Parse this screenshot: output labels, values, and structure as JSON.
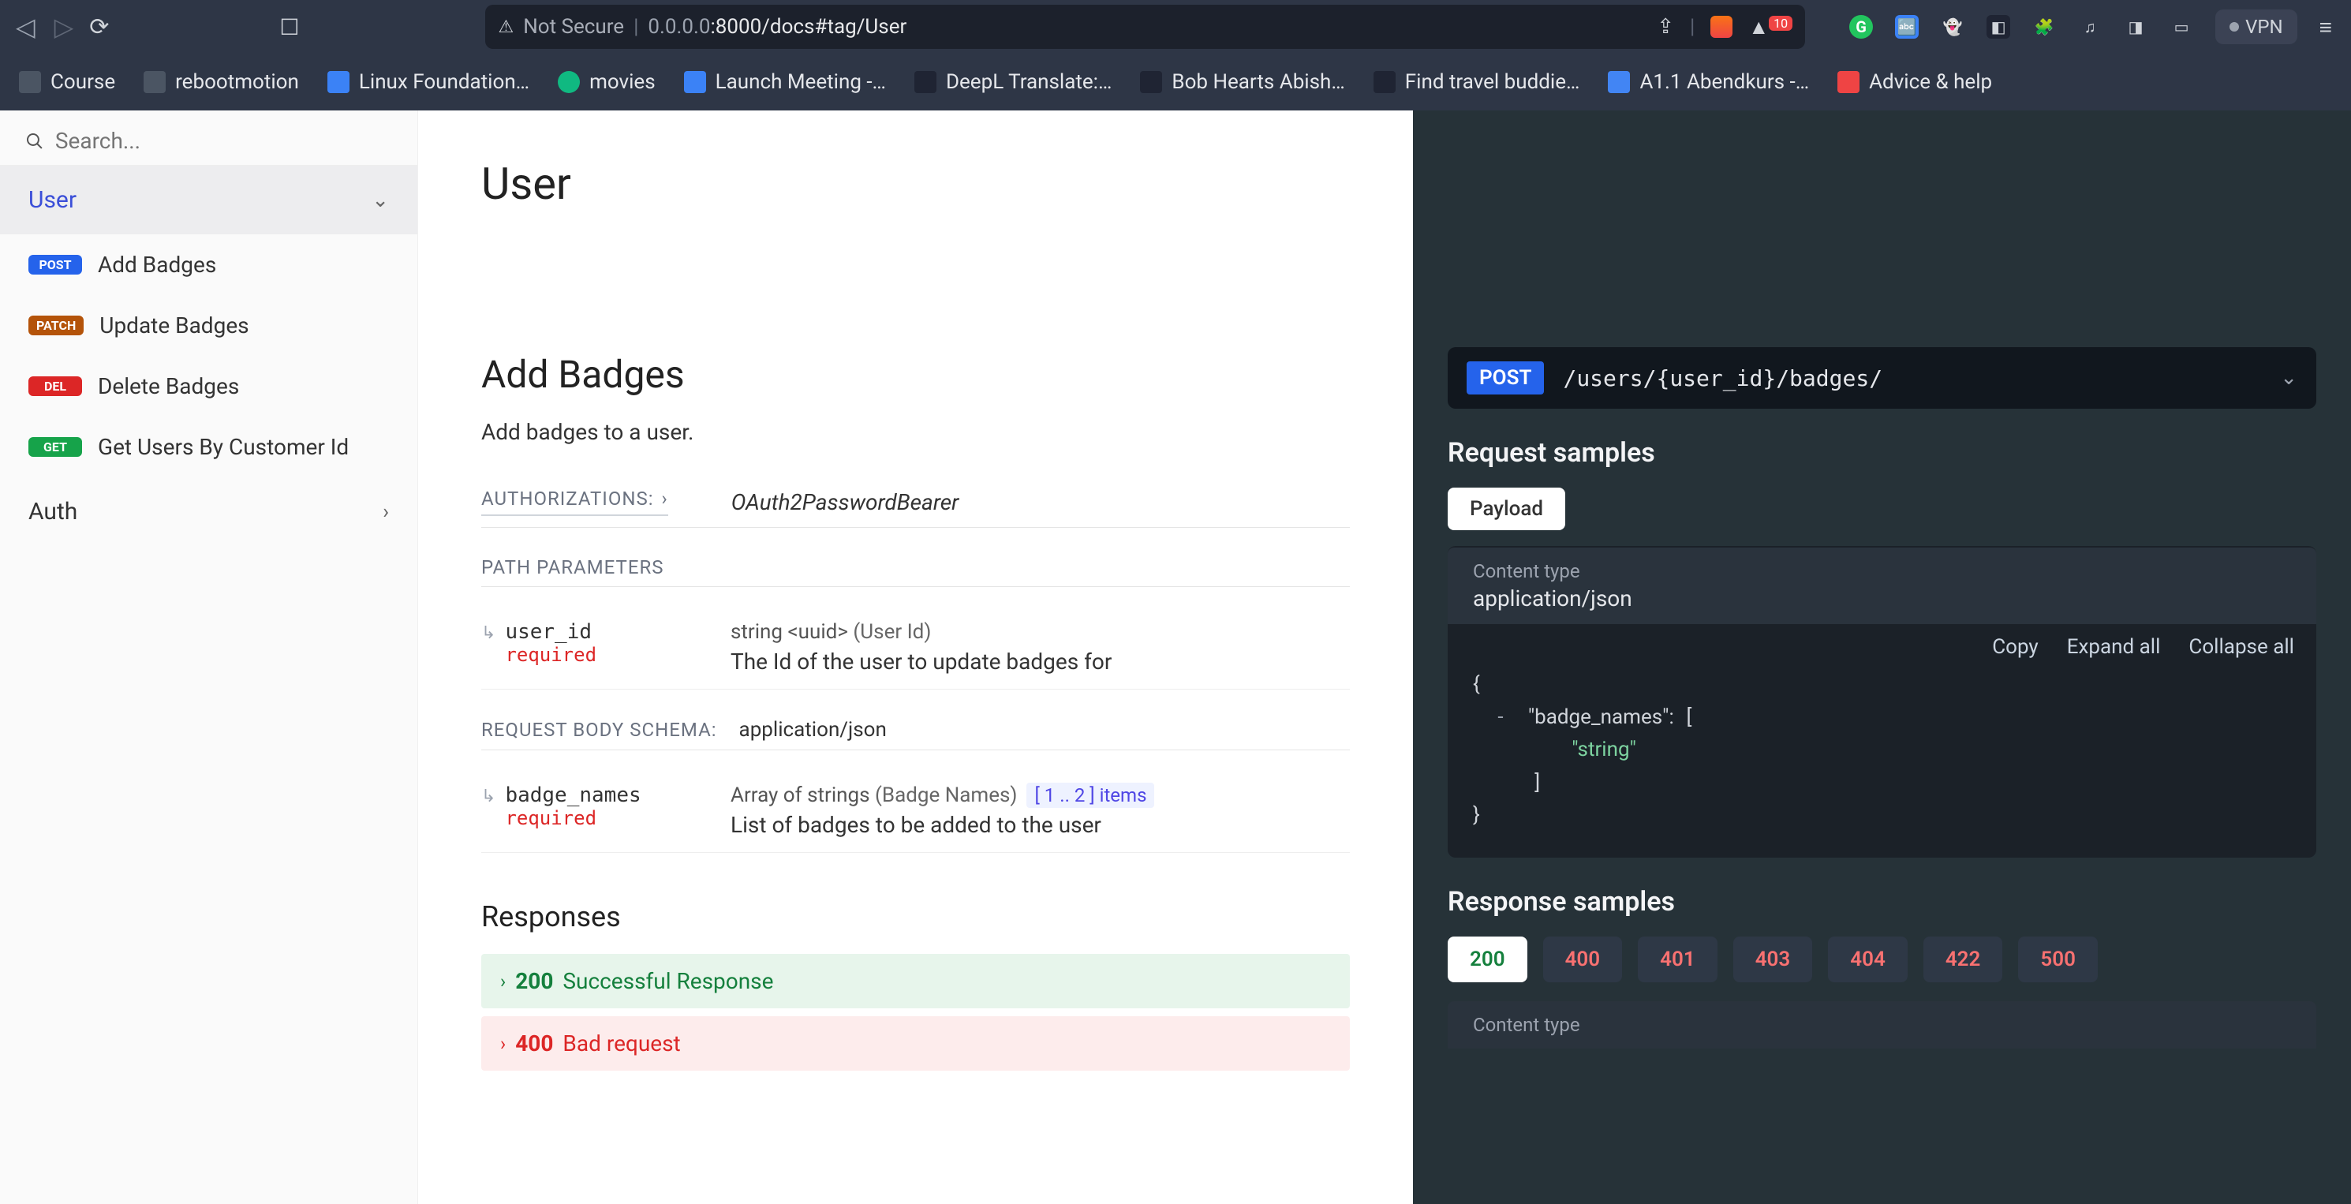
{
  "browser": {
    "not_secure": "Not Secure",
    "host_dim": "0.0.0.0",
    "host_rest": ":8000/docs#tag/User",
    "vpn": "VPN",
    "ext_badge": "10"
  },
  "bookmarks": [
    {
      "label": "Course",
      "iconClass": "bm-folder"
    },
    {
      "label": "rebootmotion",
      "iconClass": "bm-folder"
    },
    {
      "label": "Linux Foundation…",
      "iconClass": "bm-blue"
    },
    {
      "label": "movies",
      "iconClass": "bm-green"
    },
    {
      "label": "Launch Meeting -…",
      "iconClass": "bm-blue"
    },
    {
      "label": "DeepL Translate:…",
      "iconClass": "bm-dark"
    },
    {
      "label": "Bob Hearts Abish…",
      "iconClass": "bm-dark"
    },
    {
      "label": "Find travel buddie…",
      "iconClass": "bm-dark"
    },
    {
      "label": "A1.1 Abendkurs -…",
      "iconClass": "bm-doc"
    },
    {
      "label": "Advice & help",
      "iconClass": "bm-red"
    }
  ],
  "search": {
    "placeholder": "Search..."
  },
  "sidebar": {
    "section_user": "User",
    "section_auth": "Auth",
    "items": [
      {
        "method": "POST",
        "methodClass": "method-post",
        "label": "Add Badges"
      },
      {
        "method": "PATCH",
        "methodClass": "method-patch",
        "label": "Update Badges"
      },
      {
        "method": "DEL",
        "methodClass": "method-del",
        "label": "Delete Badges"
      },
      {
        "method": "GET",
        "methodClass": "method-get",
        "label": "Get Users By Customer Id"
      }
    ]
  },
  "content": {
    "page_title": "User",
    "op_title": "Add Badges",
    "op_desc": "Add badges to a user.",
    "authz_label": "AUTHORIZATIONS:",
    "authz_value": "OAuth2PasswordBearer",
    "path_params_label": "PATH PARAMETERS",
    "param1": {
      "name": "user_id",
      "req": "required",
      "type": "string <uuid>",
      "paren": "(User Id)",
      "desc": "The Id of the user to update badges for"
    },
    "req_body_label": "REQUEST BODY SCHEMA:",
    "req_body_ct": "application/json",
    "param2": {
      "name": "badge_names",
      "req": "required",
      "type": "Array of strings",
      "paren": "(Badge Names)",
      "range": "[ 1 .. 2 ] items",
      "desc": "List of badges to be added to the user"
    },
    "responses_label": "Responses",
    "resp_ok_code": "200",
    "resp_ok_text": "Successful Response",
    "resp_bad_code": "400",
    "resp_bad_text": "Bad request"
  },
  "panel": {
    "method": "POST",
    "path": "/users/{user_id}/badges/",
    "req_samples": "Request samples",
    "payload_tab": "Payload",
    "ct_label": "Content type",
    "ct_val": "application/json",
    "copy": "Copy",
    "expand": "Expand all",
    "collapse": "Collapse all",
    "json": {
      "open": "{",
      "dash": "-",
      "key": "\"badge_names\":",
      "bopen": "[",
      "str": "\"string\"",
      "bclose": "]",
      "close": "}"
    },
    "resp_samples": "Response samples",
    "codes": [
      "200",
      "400",
      "401",
      "403",
      "404",
      "422",
      "500"
    ],
    "ct_label2": "Content type"
  }
}
